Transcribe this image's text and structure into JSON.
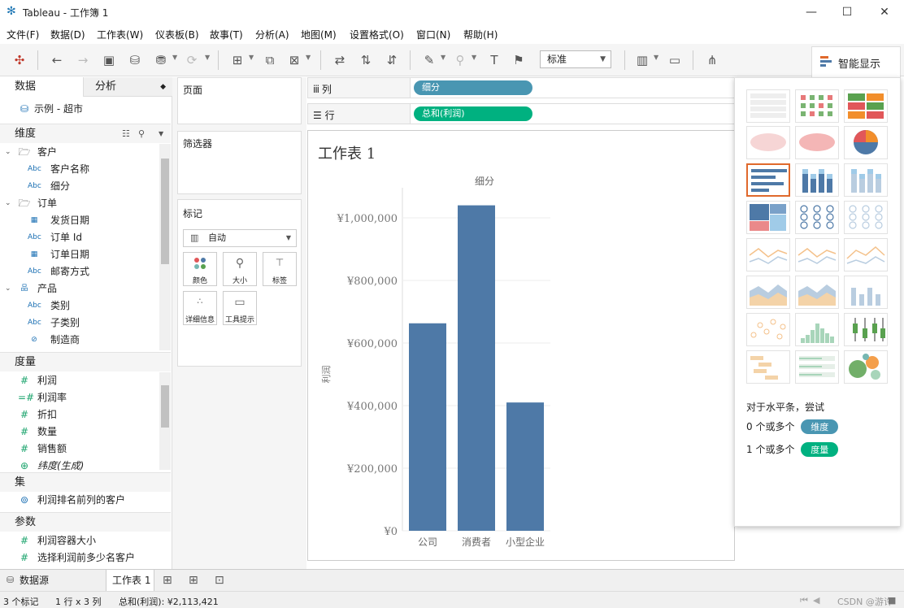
{
  "window": {
    "title": "Tableau - 工作簿 1"
  },
  "menu": [
    "文件(F)",
    "数据(D)",
    "工作表(W)",
    "仪表板(B)",
    "故事(T)",
    "分析(A)",
    "地图(M)",
    "设置格式(O)",
    "窗口(N)",
    "帮助(H)"
  ],
  "toolbar": {
    "fit_value": "标准",
    "show_me_label": "智能显示"
  },
  "data_pane": {
    "tabs": [
      "数据",
      "分析"
    ],
    "datasource": "示例 - 超市",
    "dimensions_label": "维度",
    "dimension_tree": [
      {
        "type": "folder",
        "label": "客户"
      },
      {
        "type": "abc",
        "label": "客户名称"
      },
      {
        "type": "abc",
        "label": "细分"
      },
      {
        "type": "folder",
        "label": "订单"
      },
      {
        "type": "date",
        "label": "发货日期"
      },
      {
        "type": "abc",
        "label": "订单 Id"
      },
      {
        "type": "date",
        "label": "订单日期"
      },
      {
        "type": "abc",
        "label": "邮寄方式"
      },
      {
        "type": "hier",
        "label": "产品"
      },
      {
        "type": "abc",
        "label": "类别"
      },
      {
        "type": "abc",
        "label": "子类别"
      },
      {
        "type": "link",
        "label": "制造商"
      }
    ],
    "abc_tag": "Abc",
    "measures_label": "度量",
    "measures": [
      "利润",
      "利润率",
      "折扣",
      "数量",
      "销售额",
      "纬度(生成)"
    ],
    "sets_label": "集",
    "sets": [
      "利润排名前列的客户"
    ],
    "params_label": "参数",
    "params": [
      "利润容器大小",
      "选择利润前多少名客户"
    ]
  },
  "cards": {
    "pages": "页面",
    "filters": "筛选器",
    "marks": "标记",
    "mark_type": "自动",
    "mark_buttons": [
      "颜色",
      "大小",
      "标签",
      "详细信息",
      "工具提示"
    ]
  },
  "shelves": {
    "columns_label": "列",
    "columns_pill": "细分",
    "rows_label": "行",
    "rows_pill": "总和(利润)"
  },
  "sheet": {
    "title": "工作表 1"
  },
  "chart_data": {
    "type": "bar",
    "title": "细分",
    "categories": [
      "公司",
      "消费者",
      "小型企业"
    ],
    "values": [
      663000,
      1040000,
      410000
    ],
    "ylabel": "利润",
    "ylim": [
      0,
      1100000
    ],
    "yticks": [
      "¥0",
      "¥200,000",
      "¥400,000",
      "¥600,000",
      "¥800,000",
      "¥1,000,000"
    ],
    "bar_color": "#4e79a7",
    "grid": true
  },
  "show_me": {
    "hint": "对于水平条，尝试",
    "req1_prefix": "0 个或多个",
    "req1_pill": "维度",
    "req2_prefix": "1 个或多个",
    "req2_pill": "度量"
  },
  "bottom_tabs": [
    "数据源",
    "工作表 1"
  ],
  "status": {
    "marks": "3 个标记",
    "dims": "1 行 x 3 列",
    "sum": "总和(利润): ¥2,113,421",
    "watermark": "CSDN @游许"
  },
  "colors": {
    "dim_pill": "#4996b2",
    "measure_pill": "#00b180",
    "accent": "#e0692c"
  }
}
